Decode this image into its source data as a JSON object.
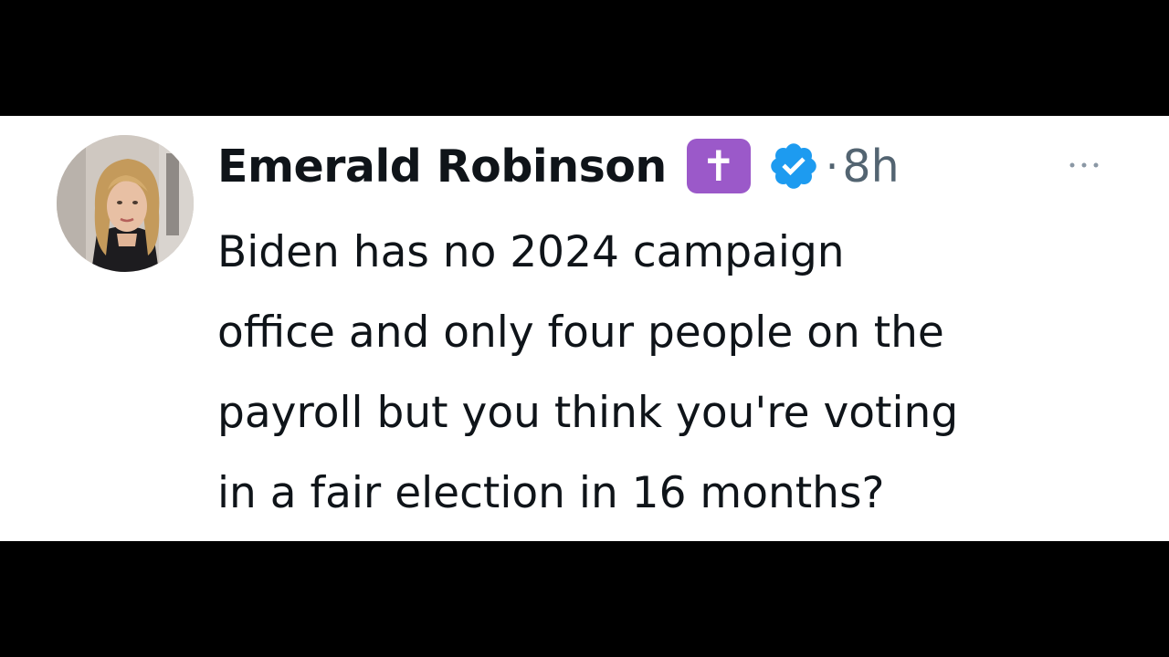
{
  "tweet": {
    "author": {
      "display_name": "Emerald Robinson",
      "badge_emoji": "✝️",
      "badge_glyph": "✝",
      "badge_color": "#9b59c9",
      "verified": true,
      "verified_color": "#1d9bf0",
      "avatar_icon": "profile-photo"
    },
    "separator": "·",
    "timestamp": "8h",
    "more_icon": "ellipsis-icon",
    "text_lines": [
      "Biden has no 2024 campaign",
      "office and only four people on the",
      "payroll but you think you're voting",
      "in a fair election in 16 months?"
    ]
  },
  "colors": {
    "background_letterbox": "#000000",
    "card_background": "#ffffff",
    "primary_text": "#0f1419",
    "secondary_text": "#536471"
  }
}
